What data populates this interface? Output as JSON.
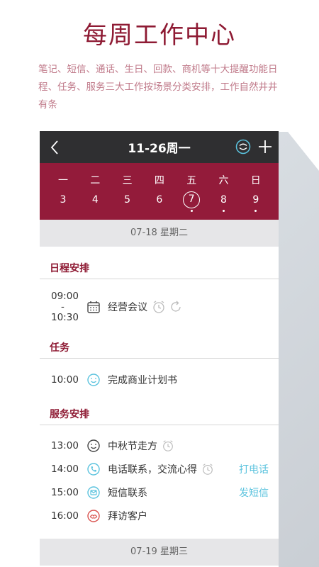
{
  "promo": {
    "title": "每周工作中心",
    "desc": "笔记、短信、通话、生日、回款、商机等十大提醒功能日程、任务、服务三大工作按场景分类安排，工作自然井井有条"
  },
  "topbar": {
    "title": "11-26周一"
  },
  "week": [
    {
      "name": "一",
      "num": "3",
      "dot": false,
      "today": false
    },
    {
      "name": "二",
      "num": "4",
      "dot": false,
      "today": false
    },
    {
      "name": "三",
      "num": "5",
      "dot": false,
      "today": false
    },
    {
      "name": "四",
      "num": "6",
      "dot": false,
      "today": false
    },
    {
      "name": "五",
      "num": "7",
      "dot": true,
      "today": true
    },
    {
      "name": "六",
      "num": "8",
      "dot": true,
      "today": false
    },
    {
      "name": "日",
      "num": "9",
      "dot": true,
      "today": false
    }
  ],
  "day1": {
    "header": "07-18 星期二"
  },
  "schedule": {
    "title": "日程安排",
    "item": {
      "start": "09:00",
      "sep": "-",
      "end": "10:30",
      "text": "经营会议"
    }
  },
  "tasks": {
    "title": "任务",
    "item": {
      "time": "10:00",
      "text": "完成商业计划书"
    }
  },
  "service": {
    "title": "服务安排",
    "items": [
      {
        "time": "13:00",
        "text": "中秋节走方",
        "action": ""
      },
      {
        "time": "14:00",
        "text": "电话联系，交流心得",
        "action": "打电话"
      },
      {
        "time": "15:00",
        "text": "短信联系",
        "action": "发短信"
      },
      {
        "time": "16:00",
        "text": "拜访客户",
        "action": ""
      }
    ]
  },
  "day2": {
    "header": "07-19 星期三"
  },
  "colors": {
    "brand": "#931b3a",
    "topbar": "#2f2f31",
    "accent": "#5bc3de"
  }
}
